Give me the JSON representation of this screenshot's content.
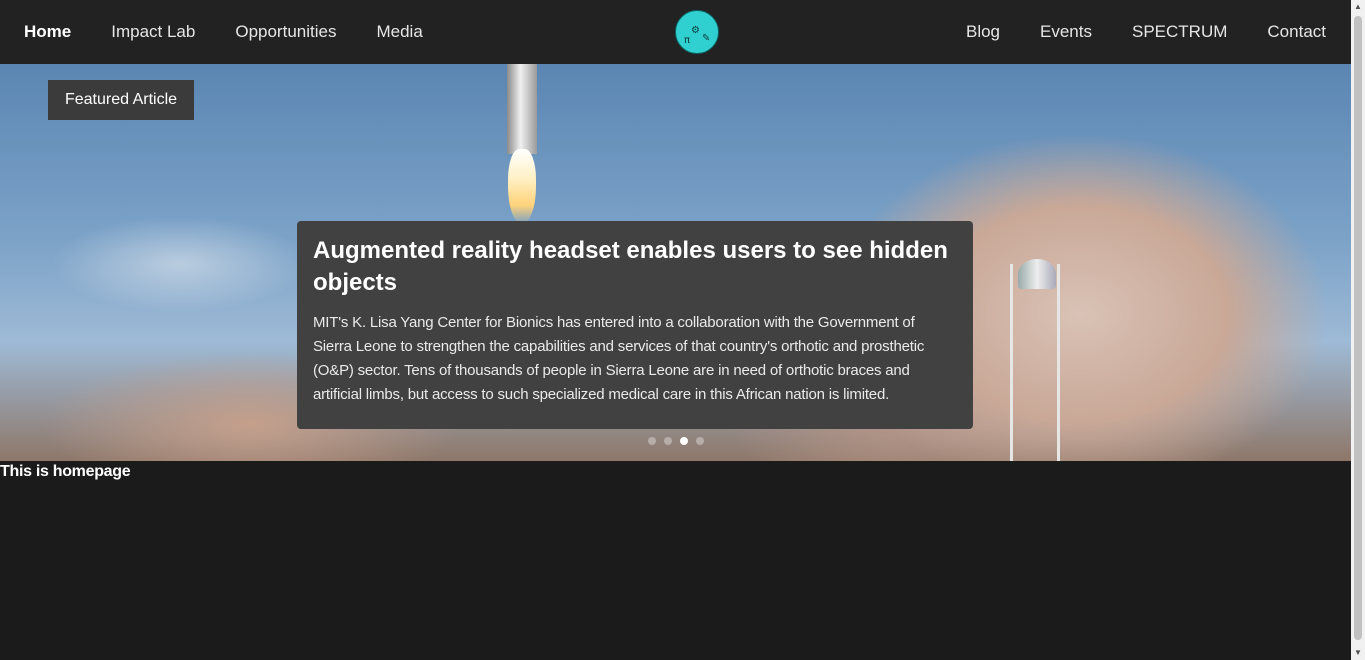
{
  "nav": {
    "left_items": [
      "Home",
      "Impact Lab",
      "Opportunities",
      "Media"
    ],
    "right_items": [
      "Blog",
      "Events",
      "SPECTRUM",
      "Contact"
    ],
    "active": "Home",
    "logo_icon": "club-logo-icon"
  },
  "hero": {
    "tag": "Featured Article",
    "title": "Augmented reality headset enables users to see hidden objects",
    "body": "MIT's K. Lisa Yang Center for Bionics has entered into a collaboration with the Government of Sierra Leone to strengthen the capabilities and services of that country's orthotic and prosthetic (O&P) sector. Tens of thousands of people in Sierra Leone are in need of orthotic braces and artificial limbs, but access to such specialized medical care in this African nation is limited.",
    "slides_total": 4,
    "active_slide": 3
  },
  "main": {
    "text": "This is homepage"
  },
  "colors": {
    "nav_bg": "#222222",
    "page_bg": "#1b1b1b",
    "card_bg": "#414141",
    "logo": "#2fd0cf"
  }
}
